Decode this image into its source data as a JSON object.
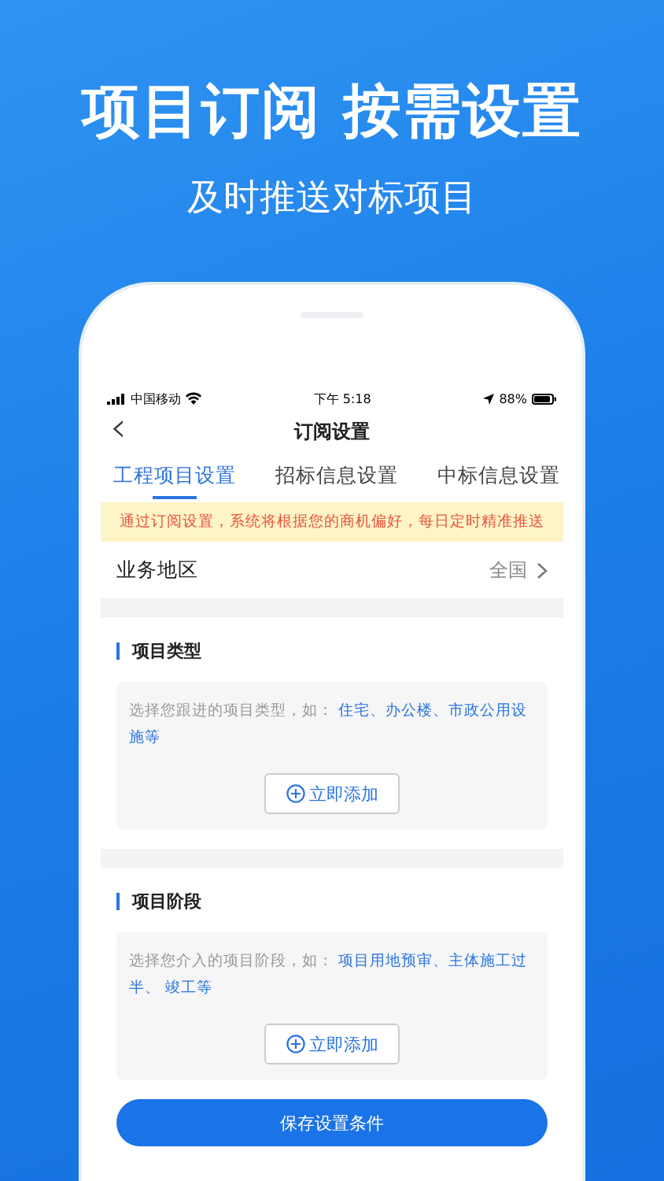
{
  "headline": "项目订阅 按需设置",
  "subtitle": "及时推送对标项目",
  "status_bar": {
    "carrier": "中国移动",
    "time": "下午 5:18",
    "battery": "88%"
  },
  "nav": {
    "back": "‹",
    "title": "订阅设置"
  },
  "tabs": [
    {
      "label": "工程项目设置",
      "selected": true
    },
    {
      "label": "招标信息设置",
      "selected": false
    },
    {
      "label": "中标信息设置",
      "selected": false
    }
  ],
  "notice": "通过订阅设置，系统将根据您的商机偏好，每日定时精准推送",
  "region": {
    "label": "业务地区",
    "value": "全国"
  },
  "sections": [
    {
      "title": "项目类型",
      "hint": "选择您跟进的项目类型，如：",
      "examples": "住宅、办公楼、市政公用设施等",
      "button": "立即添加"
    },
    {
      "title": "项目阶段",
      "hint": "选择您介入的项目阶段，如：",
      "examples": "项目用地预审、主体施工过半、 竣工等",
      "button": "立即添加"
    }
  ],
  "save_button": "保存设置条件"
}
